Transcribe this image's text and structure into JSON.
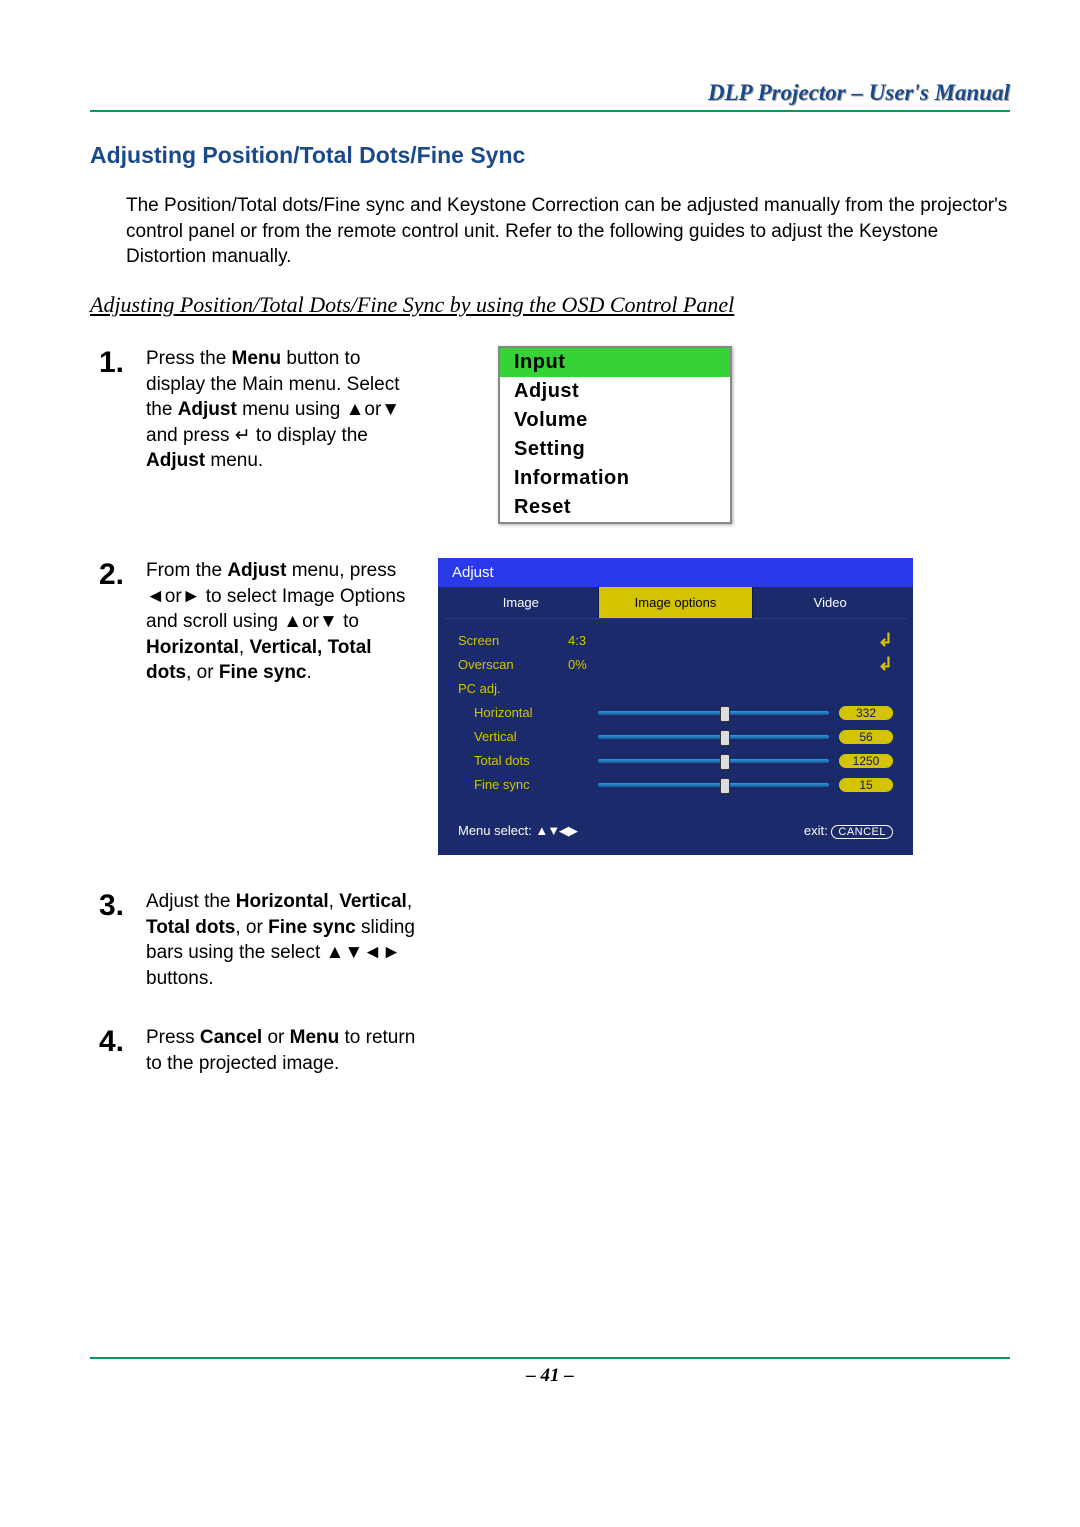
{
  "header": {
    "doc_title": "DLP Projector – User's Manual"
  },
  "section": {
    "heading": "Adjusting Position/Total Dots/Fine Sync",
    "intro": "The Position/Total dots/Fine sync and Keystone Correction can be adjusted manually from the projector's control panel or from the remote control unit. Refer to the following guides to adjust the Keystone Distortion manually.",
    "sub_heading": "Adjusting Position/Total Dots/Fine Sync by using the OSD Control Panel"
  },
  "steps": {
    "s1": {
      "num": "1.",
      "t1": "Press the ",
      "b1": "Menu",
      "t2": " button to display the Main menu. Select the ",
      "b2": "Adjust",
      "t3": " menu using ▲or▼ and press ↵ to display the ",
      "b3": "Adjust",
      "t4": " menu."
    },
    "s2": {
      "num": "2.",
      "t1": "From the ",
      "b1": "Adjust",
      "t2": " menu, press ◄or► to select Image Options and scroll using ▲or▼ to ",
      "b2": "Horizontal",
      "t3": ", ",
      "b3": "Vertical, Total dots",
      "t4": ", or ",
      "b4": "Fine sync",
      "t5": "."
    },
    "s3": {
      "num": "3.",
      "t1": "Adjust the ",
      "b1": "Horizontal",
      "t2": ", ",
      "b2": "Vertical",
      "t3": ", ",
      "b3": "Total dots",
      "t4": ", or ",
      "b4": "Fine sync",
      "t5": " sliding bars using the select ▲▼◄► buttons."
    },
    "s4": {
      "num": "4.",
      "t1": "Press ",
      "b1": "Cancel",
      "t2": " or ",
      "b2": "Menu",
      "t3": " to return to the projected image."
    }
  },
  "main_menu": {
    "items": [
      "Input",
      "Adjust",
      "Volume",
      "Setting",
      "Information",
      "Reset"
    ]
  },
  "osd": {
    "title": "Adjust",
    "tabs": [
      "Image",
      "Image options",
      "Video"
    ],
    "screen_label": "Screen",
    "screen_val": "4:3",
    "overscan_label": "Overscan",
    "overscan_val": "0%",
    "pcadj_label": "PC adj.",
    "horizontal_label": "Horizontal",
    "horizontal_val": "332",
    "vertical_label": "Vertical",
    "vertical_val": "56",
    "totaldots_label": "Total dots",
    "totaldots_val": "1250",
    "finesync_label": "Fine sync",
    "finesync_val": "15",
    "footer_left": "Menu select:",
    "footer_arrows": "▲▼◀▶",
    "footer_right_pre": "exit:",
    "footer_cancel": "CANCEL"
  },
  "footer": {
    "page_num": "– 41 –"
  }
}
